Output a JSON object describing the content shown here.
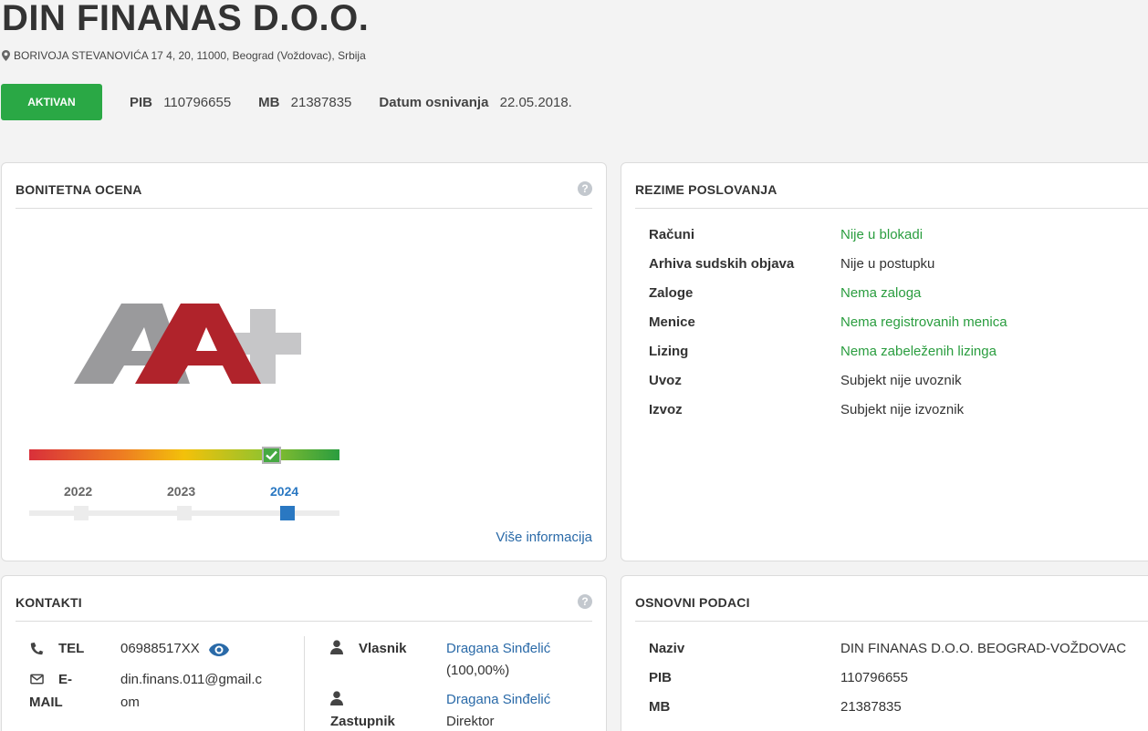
{
  "company": {
    "name": "DIN FINANAS D.O.O.",
    "address": "BORIVOJA STEVANOVIĆA 17 4, 20, 11000, Beograd (Voždovac), Srbija",
    "status": "AKTIVAN",
    "pib_label": "PIB",
    "pib": "110796655",
    "mb_label": "MB",
    "mb": "21387835",
    "founded_label": "Datum osnivanja",
    "founded": "22.05.2018."
  },
  "rating": {
    "title": "BONITETNA OCENA",
    "grade": "AA+",
    "scale_position": 0.78,
    "years": [
      "2022",
      "2023",
      "2024"
    ],
    "active_year": "2024",
    "more_link": "Više informacija"
  },
  "summary": {
    "title": "REZIME POSLOVANJA",
    "rows": [
      {
        "label": "Računi",
        "value": "Nije u blokadi"
      },
      {
        "label": "Arhiva sudskih objava",
        "value": "Nije u postupku"
      },
      {
        "label": "Zaloge",
        "value": "Nema zaloga"
      },
      {
        "label": "Menice",
        "value": "Nema registrovanih menica"
      },
      {
        "label": "Lizing",
        "value": "Nema zabeleženih lizinga"
      },
      {
        "label": "Uvoz",
        "value": "Subjekt nije uvoznik"
      },
      {
        "label": "Izvoz",
        "value": "Subjekt nije izvoznik"
      }
    ]
  },
  "contacts": {
    "title": "KONTAKTI",
    "tel_label": "TEL",
    "tel": "06988517XX",
    "email_label_1": "E-",
    "email_label_2": "MAIL",
    "email_1": "din.finans.011@gmail.c",
    "email_2": "om",
    "owner_label": "Vlasnik",
    "owner_name": "Dragana Sinđelić",
    "owner_share": "(100,00%)",
    "rep_label": "Zastupnik",
    "rep_name": "Dragana Sinđelić",
    "rep_role": "Direktor"
  },
  "basic": {
    "title": "OSNOVNI PODACI",
    "rows": [
      {
        "label": "Naziv",
        "value": "DIN FINANAS D.O.O. BEOGRAD-VOŽDOVAC"
      },
      {
        "label": "PIB",
        "value": "110796655"
      },
      {
        "label": "MB",
        "value": "21387835"
      }
    ]
  },
  "colors": {
    "accent_green": "#2aa845",
    "link_blue": "#2a6aa8",
    "grade_red": "#b0232b",
    "grade_gray": "#9a9a9c"
  }
}
